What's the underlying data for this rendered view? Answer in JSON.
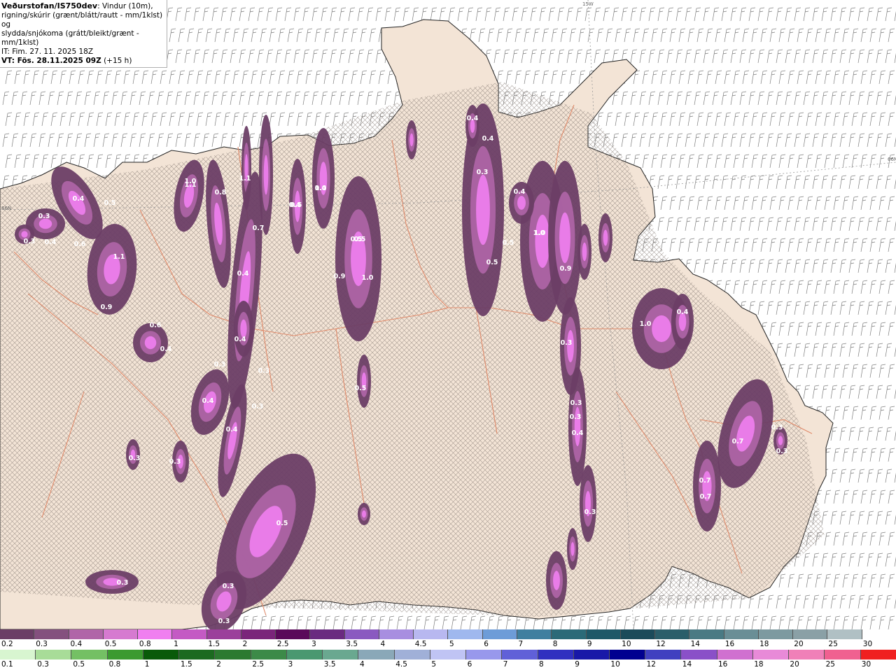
{
  "header": {
    "title": "Veðurstofan/IS750dev",
    "desc_1": ": Vindur (10m),",
    "desc_2": "rigning/skúrir (grænt/blátt/rautt - mm/1klst) og",
    "desc_3": "slydda/snjókoma (grátt/bleikt/grænt - mm/1klst)",
    "it": "IT: Fim. 27. 11. 2025 18Z",
    "vt": "VT: Fös. 28.11.2025 09Z",
    "lead": " (+15 h)"
  },
  "graticule": {
    "lon_label": "15W",
    "lat_label_left": "66N",
    "lat_label_right": "66N"
  },
  "precip_labels": [
    "0.3",
    "0.3",
    "0.4",
    "0.5",
    "1.0",
    "0.8",
    "1.1",
    "0.7",
    "0.4",
    "0.4",
    "0.4",
    "0.6",
    "1.1",
    "0.9",
    "0.6",
    "0.4",
    "1.1",
    "1.0",
    "0.5",
    "0.9",
    "1.0",
    "0.5",
    "0.4",
    "0.4",
    "0.3",
    "0.3",
    "0.4",
    "0.3",
    "0.4",
    "0.3",
    "0.5",
    "0.3",
    "0.5",
    "0.3",
    "0.3",
    "0.3",
    "0.5",
    "1.0",
    "0.4",
    "0.5",
    "1.0",
    "0.9",
    "0.5",
    "0.3",
    "0.4",
    "0.4",
    "0.3",
    "0.3",
    "0.3",
    "0.4",
    "1.0",
    "0.4",
    "0.7",
    "0.3",
    "0.3",
    "0.7",
    "0.7",
    "0.3"
  ],
  "colorbar_snow": {
    "labels": [
      "0.2",
      "0.3",
      "0.4",
      "0.5",
      "0.8",
      "1",
      "1.5",
      "2",
      "2.5",
      "3",
      "3.5",
      "4",
      "4.5",
      "5",
      "6",
      "7",
      "8",
      "9",
      "10",
      "12",
      "14",
      "16",
      "18",
      "20",
      "25",
      "30"
    ],
    "colors": [
      "#6b3e66",
      "#84507e",
      "#b065a8",
      "#d67ad0",
      "#f07ff0",
      "#c45ac4",
      "#9b3f9b",
      "#7a257a",
      "#5a0a5a",
      "#6a2a80",
      "#8a5ac0",
      "#a88ee0",
      "#b8b8f0",
      "#9fb8ee",
      "#6d9cd8",
      "#3f7f9f",
      "#2b6a78",
      "#1e5868",
      "#1b4b5a",
      "#2a5e6a",
      "#4a7a84",
      "#6a8e96",
      "#7d9aa0",
      "#8aa0a6",
      "#b0c0c4",
      "#ffffff"
    ]
  },
  "colorbar_rain": {
    "labels": [
      "0.1",
      "0.3",
      "0.5",
      "0.8",
      "1",
      "1.5",
      "2",
      "2.5",
      "3",
      "3.5",
      "4",
      "4.5",
      "5",
      "6",
      "7",
      "8",
      "9",
      "10",
      "12",
      "14",
      "16",
      "18",
      "20",
      "25",
      "30"
    ],
    "colors": [
      "#d8f5d0",
      "#a8dc98",
      "#74c064",
      "#3c9a30",
      "#0a5a0a",
      "#1c6a20",
      "#2c7a30",
      "#3c8a48",
      "#4a9870",
      "#6aa890",
      "#8aa8b8",
      "#a0b0d8",
      "#c0c4f4",
      "#9898ec",
      "#6060d8",
      "#3030c0",
      "#1818a8",
      "#000090",
      "#4040c0",
      "#8a50c8",
      "#d070d0",
      "#e88ad8",
      "#f080b8",
      "#f06090",
      "#f02020"
    ]
  }
}
